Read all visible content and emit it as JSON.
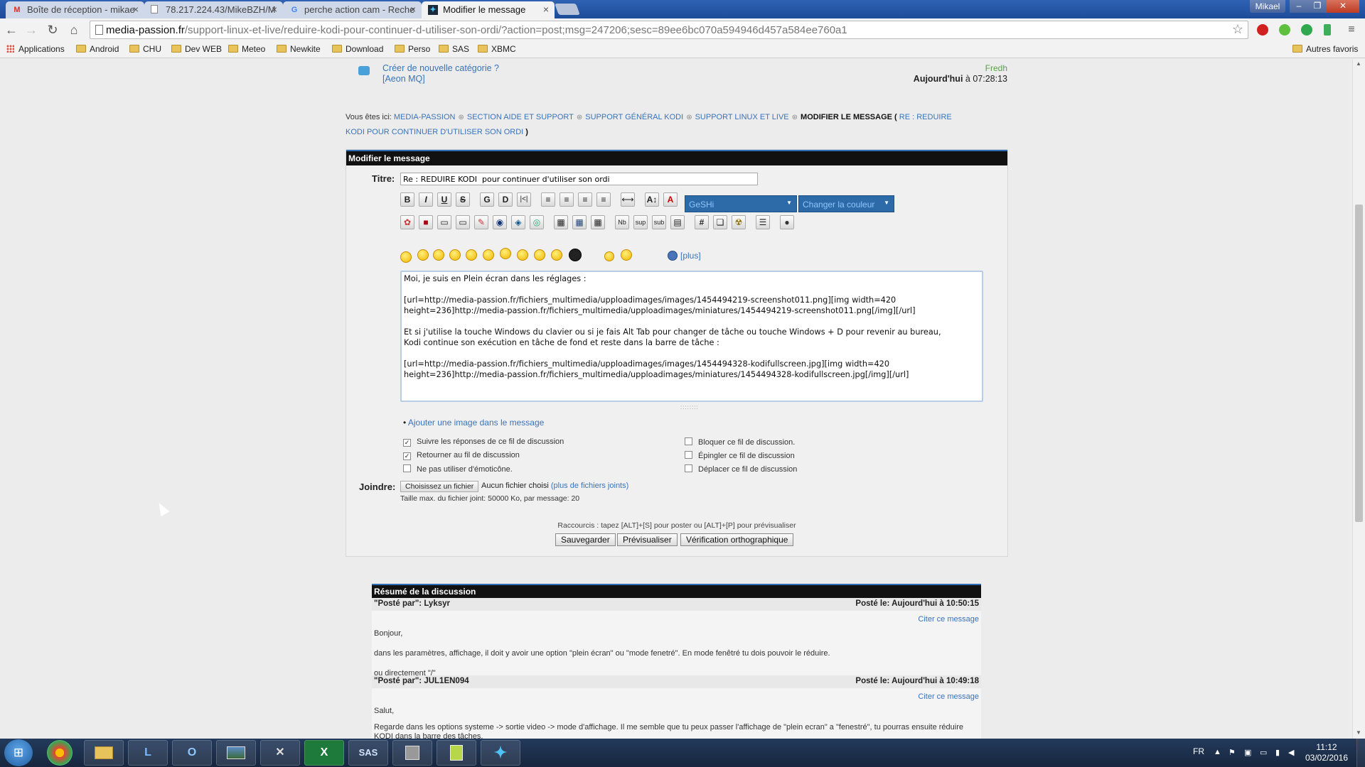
{
  "browser": {
    "tabs": [
      {
        "title": "Boîte de réception - mikae",
        "icon": "gmail-icon"
      },
      {
        "title": "78.217.224.43/MikeBZH/M",
        "icon": "page-icon"
      },
      {
        "title": "perche action cam - Reche",
        "icon": "google-icon"
      },
      {
        "title": "Modifier le message",
        "icon": "kodi-icon",
        "active": true
      }
    ],
    "user": "Mikael",
    "url_host": "media-passion.fr",
    "url_path": "/support-linux-et-live/reduire-kodi-pour-continuer-d-utiliser-son-ordi/?action=post;msg=247206;sesc=89ee6bc070a594946d457a584ee760a1",
    "bookmarks": [
      "Applications",
      "Android",
      "CHU",
      "Dev WEB",
      "Meteo",
      "Newkite",
      "Download",
      "Perso",
      "SAS",
      "XBMC"
    ],
    "other_bookmarks": "Autres favoris"
  },
  "last_post": {
    "title": "Créer de nouvelle catégorie ?",
    "subtitle": "[Aeon MQ]",
    "author": "Fredh",
    "date_prefix": "Aujourd'hui",
    "date_suffix": "à 07:28:13"
  },
  "breadcrumb": {
    "prefix": "Vous êtes ici:",
    "items": [
      "Media-Passion",
      "Section Aide et Support",
      "Support Général KODI",
      "Support Linux et Live"
    ],
    "current": "Modifier le message (",
    "current_link": "Re : REDUIRE KODI pour continuer d'utiliser son ordi",
    "current_end": ")"
  },
  "form": {
    "header": "Modifier le message",
    "title_label": "Titre:",
    "title_value": "Re : REDUIRE KODI  pour continuer d'utiliser son ordi",
    "format_buttons": [
      "B",
      "I",
      "U",
      "S",
      "G",
      "D",
      "|<|",
      "left",
      "center",
      "right",
      "justify",
      "hr",
      "A↕",
      "A"
    ],
    "dropdown_geshi": "GeSHi",
    "dropdown_color": "Changer la couleur",
    "plus_link": "[plus]",
    "message": "Moi, je suis en Plein écran dans les réglages :\n\n[url=http://media-passion.fr/fichiers_multimedia/upploadimages/images/1454494219-screenshot011.png][img width=420\nheight=236]http://media-passion.fr/fichiers_multimedia/upploadimages/miniatures/1454494219-screenshot011.png[/img][/url]\n\nEt si j'utilise la touche Windows du clavier ou si je fais Alt Tab pour changer de tâche ou touche Windows + D pour revenir au bureau,\nKodi continue son exécution en tâche de fond et reste dans la barre de tâche :\n\n[url=http://media-passion.fr/fichiers_multimedia/upploadimages/images/1454494328-kodifullscreen.jpg][img width=420\nheight=236]http://media-passion.fr/fichiers_multimedia/upploadimages/miniatures/1454494328-kodifullscreen.jpg[/img][/url]",
    "add_image": "Ajouter une image dans le message",
    "options_left": [
      {
        "label": "Suivre les réponses de ce fil de discussion",
        "checked": true
      },
      {
        "label": "Retourner au fil de discussion",
        "checked": true
      },
      {
        "label": "Ne pas utiliser d'émoticône.",
        "checked": false
      }
    ],
    "options_right": [
      {
        "label": "Bloquer ce fil de discussion.",
        "checked": false
      },
      {
        "label": "Épingler ce fil de discussion",
        "checked": false
      },
      {
        "label": "Déplacer ce fil de discussion",
        "checked": false
      }
    ],
    "attach_label": "Joindre:",
    "file_button": "Choisissez un fichier",
    "file_chosen": "Aucun fichier choisi",
    "more_files": "(plus de fichiers joints)",
    "file_max": "Taille max. du fichier joint: 50000 Ko, par message: 20",
    "shortcuts": "Raccourcis : tapez [ALT]+[S] pour poster ou [ALT]+[P] pour prévisualiser",
    "buttons": {
      "save": "Sauvegarder",
      "preview": "Prévisualiser",
      "spell": "Vérification orthographique"
    }
  },
  "summary": {
    "header": "Résumé de la discussion",
    "posts": [
      {
        "author": "\"Posté par\": Lyksyr",
        "date": "Posté le: Aujourd'hui à 10:50:15",
        "cite": "Citer ce message",
        "lines": [
          "Bonjour,",
          "dans les paramètres, affichage, il doit y avoir une option \"plein écran\" ou \"mode fenetré\". En mode fenêtré tu dois pouvoir le réduire.",
          "ou directement \"/\""
        ]
      },
      {
        "author": "\"Posté par\": JUL1EN094",
        "date": "Posté le: Aujourd'hui à 10:49:18",
        "cite": "Citer ce message",
        "lines": [
          "Salut,",
          "Regarde dans les options systeme -> sortie video -> mode d'affichage. Il me semble que tu peux passer l'affichage de \"plein ecran\" a \"fenestré\", tu pourras ensuite réduire",
          "KODI dans la barre des tâches."
        ]
      }
    ]
  },
  "taskbar": {
    "apps": [
      "chrome-icon",
      "explorer-icon",
      "lync-icon",
      "outlook-icon",
      "image-icon",
      "xbox-icon",
      "excel-icon",
      "sas-icon",
      "network-icon",
      "notepad-icon",
      "kodi-icon"
    ],
    "app_labels": [
      "",
      "",
      "L",
      "O",
      "",
      "✕",
      "X",
      "SAS",
      "",
      "",
      "✦"
    ],
    "lang": "FR",
    "time": "11:12",
    "date": "03/02/2016"
  }
}
